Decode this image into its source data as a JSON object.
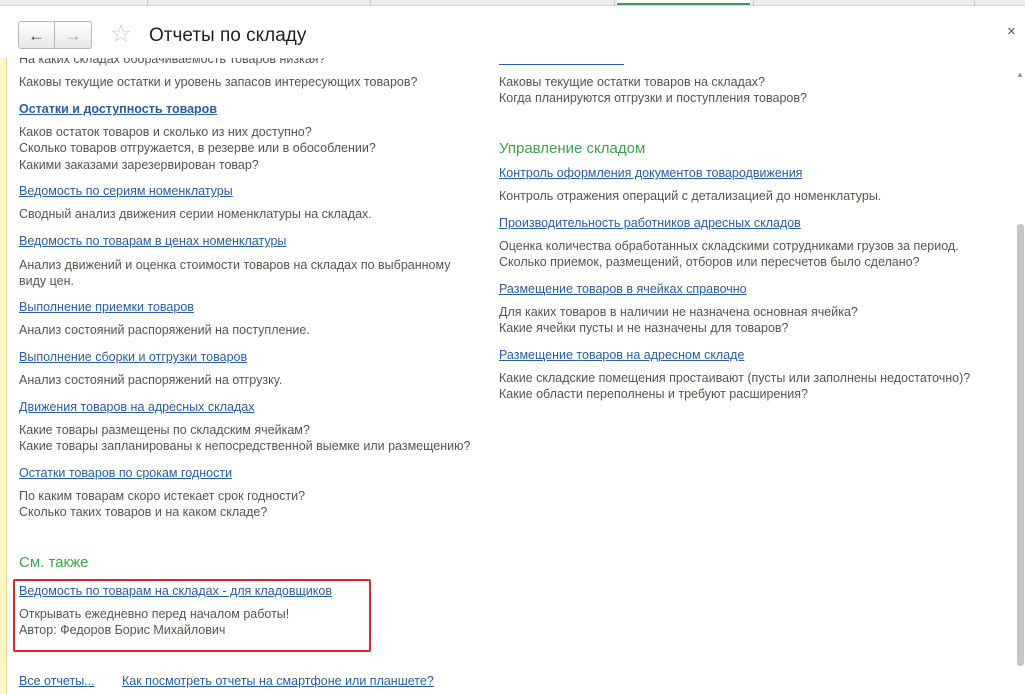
{
  "header": {
    "title": "Отчеты по складу",
    "back_glyph": "←",
    "forward_glyph": "→",
    "star_glyph": "☆",
    "close_glyph": "×"
  },
  "left_column": {
    "cut_link_line": "На каких складах оборачиваемость товаров низкая?",
    "cut_desc_line": "Каковы текущие остатки и уровень запасов интересующих товаров?",
    "reports": [
      {
        "title": "Остатки и доступность товаров",
        "description": [
          "Каков остаток товаров и сколько из них доступно?",
          "Сколько товаров отгружается, в резерве или в обособлении?",
          "Какими заказами зарезервирован товар?"
        ]
      },
      {
        "title": "Ведомость по сериям номенклатуры",
        "description": [
          "Сводный анализ движения серии номенклатуры на складах."
        ]
      },
      {
        "title": "Ведомость по товарам в ценах номенклатуры",
        "description": [
          "Анализ движений и оценка стоимости товаров на складах по выбранному",
          "виду цен."
        ]
      },
      {
        "title": "Выполнение приемки товаров",
        "description": [
          "Анализ состояний распоряжений на поступление."
        ]
      },
      {
        "title": "Выполнение сборки и отгрузки товаров",
        "description": [
          "Анализ состояний распоряжений на отгрузку."
        ]
      },
      {
        "title": "Движения товаров на адресных складах",
        "description": [
          "Какие товары размещены по складским ячейкам?",
          "Какие товары запланированы к непосредственной выемке или размещению?"
        ]
      },
      {
        "title": "Остатки товаров по срокам годности",
        "description": [
          "По каким товарам скоро истекает срок годности?",
          "Сколько таких товаров и на каком складе?"
        ]
      }
    ]
  },
  "right_column": {
    "cut_desc": [
      "Каковы текущие остатки товаров на складах?",
      "Когда планируются отгрузки и поступления товаров?"
    ],
    "section_title": "Управление складом",
    "reports": [
      {
        "title": "Контроль оформления документов товародвижения",
        "description": [
          "Контроль отражения операций с детализацией до номенклатуры."
        ]
      },
      {
        "title": "Производительность работников адресных складов",
        "description": [
          "Оценка количества обработанных складскими сотрудниками грузов за период.",
          "Сколько приемок, размещений, отборов или пересчетов было сделано?"
        ]
      },
      {
        "title": "Размещение товаров в ячейках справочно",
        "description": [
          "Для каких товаров в наличии не назначена основная ячейка?",
          "Какие ячейки пусты и не назначены для товаров?"
        ]
      },
      {
        "title": "Размещение товаров на адресном складе",
        "description": [
          "Какие складские помещения простаивают (пусты или заполнены недостаточно)?",
          "Какие области переполнены и требуют расширения?"
        ]
      }
    ]
  },
  "see_also": {
    "title": "См. также",
    "report_title": "Ведомость по товарам на складах - для кладовщиков",
    "note": "Открывать ежедневно перед началом работы!",
    "author": "Автор: Федоров Борис Михайлович"
  },
  "footer": {
    "all_reports": "Все отчеты...",
    "mobile_link": "Как посмотреть отчеты на смартфоне или планшете?"
  },
  "colors": {
    "link": "#2a5d9f",
    "section": "#3fa14d",
    "highlight_frame": "#d9262e",
    "left_bar": "#fdf6c3"
  }
}
